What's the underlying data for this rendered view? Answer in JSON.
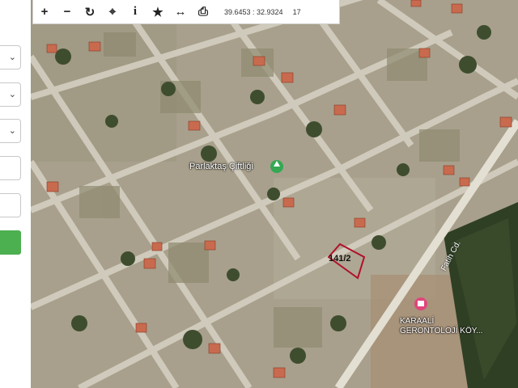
{
  "toolbar": {
    "buttons": [
      {
        "name": "zoom-in",
        "glyph": "+"
      },
      {
        "name": "zoom-out",
        "glyph": "−"
      },
      {
        "name": "refresh",
        "glyph": "↻"
      },
      {
        "name": "locate",
        "glyph": "⌖"
      },
      {
        "name": "info",
        "glyph": "i"
      },
      {
        "name": "favorite",
        "glyph": "★"
      },
      {
        "name": "measure",
        "glyph": "↔"
      },
      {
        "name": "print",
        "glyph": "⎙"
      }
    ],
    "coordinates": "39.6453 : 32.9324",
    "zoom_level": "17"
  },
  "map": {
    "poi_parlaktas": "Parlaktaş Çiftliği",
    "parcel_label": "141/2",
    "street_label": "Fatih Cd.",
    "poi_karaali": "KARAALİ\nGERONTOLOJİ KÖY..."
  },
  "colors": {
    "parcel_outline": "#b0102a",
    "poi_green": "#34a853",
    "poi_pink": "#e0457b",
    "accent_button": "#4caf50"
  }
}
